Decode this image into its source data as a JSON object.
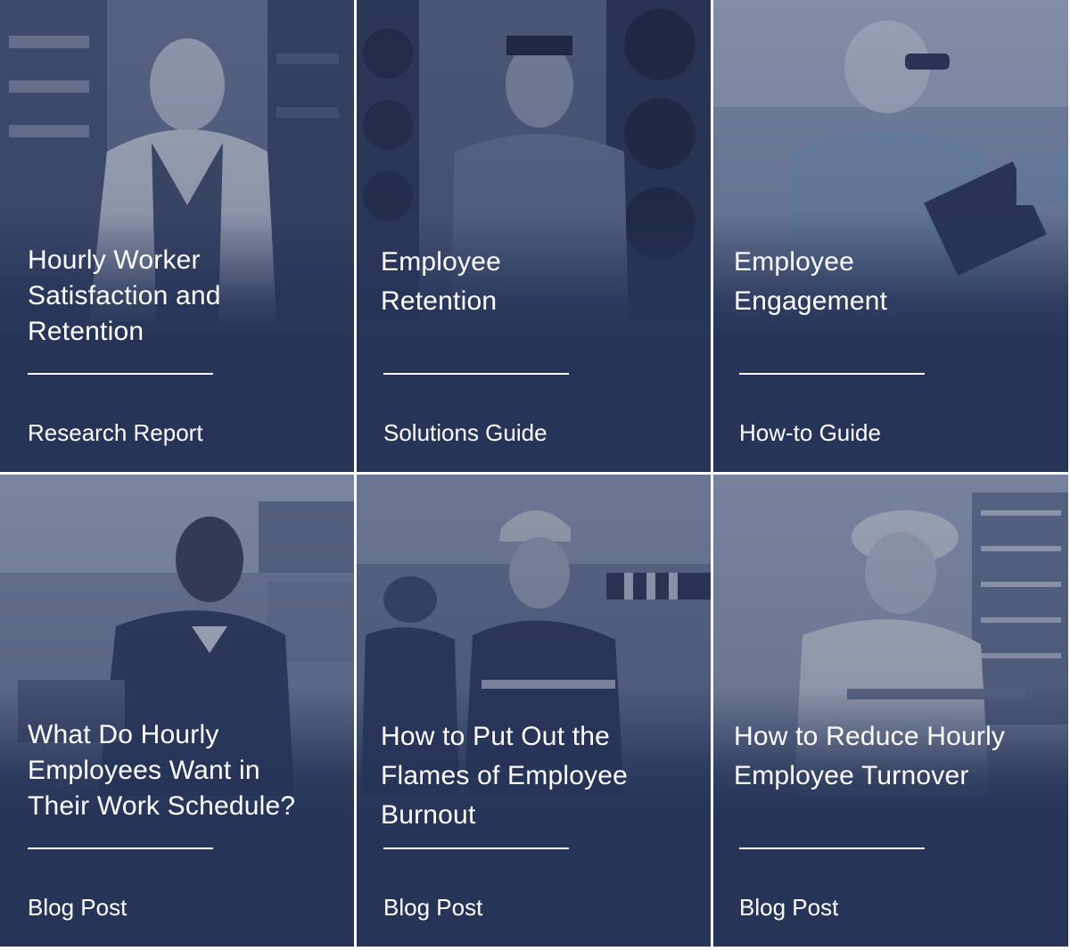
{
  "colors": {
    "overlay": "#263458",
    "text": "#ffffff",
    "divider": "#ffffff"
  },
  "cards": [
    {
      "title_lines": [
        "Hourly Worker",
        "Satisfaction and",
        "Retention"
      ],
      "type": "Research Report",
      "image": "warehouse-worker-in-vest-photo"
    },
    {
      "title_lines": [
        "Employee",
        "Retention"
      ],
      "type": "Solutions Guide",
      "image": "tire-shop-worker-photo"
    },
    {
      "title_lines": [
        "Employee",
        "Engagement"
      ],
      "type": "How-to Guide",
      "image": "lab-worker-with-clipboard-photo"
    },
    {
      "title_lines": [
        "What Do Hourly",
        "Employees Want in",
        "Their Work Schedule?"
      ],
      "type": "Blog Post",
      "image": "warehouse-worker-with-boxes-photo"
    },
    {
      "title_lines": [
        "How to Put Out the",
        "Flames of Employee",
        "Burnout"
      ],
      "type": "Blog Post",
      "image": "industrial-workers-hard-hats-photo"
    },
    {
      "title_lines": [
        "How to Reduce Hourly",
        "Employee Turnover"
      ],
      "type": "Blog Post",
      "image": "bakery-worker-hairnet-photo"
    }
  ]
}
